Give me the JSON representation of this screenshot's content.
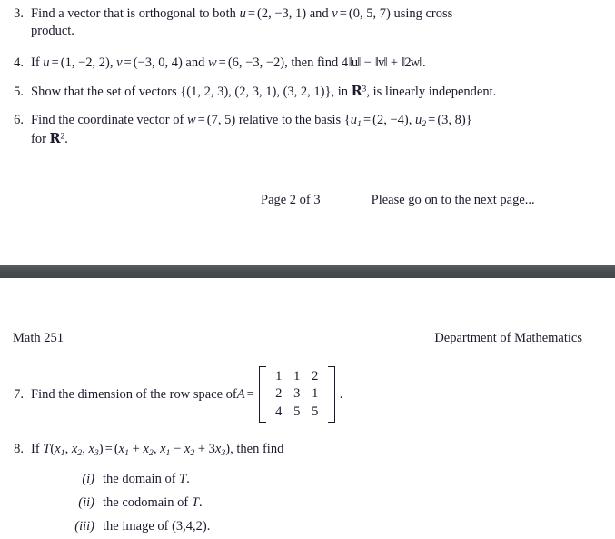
{
  "document": {
    "course": "Math 251",
    "department": "Department of Mathematics",
    "page_label": "Page 2 of 3",
    "continuation_note": "Please go on to the next page...",
    "divider_color": "#4a4e53"
  },
  "problems": {
    "q3": {
      "number": "3.",
      "line1_a": "Find a vector that is orthogonal to both ",
      "u": "u",
      "eq1": "=",
      "u_val": "(2, −3, 1)",
      "and": " and ",
      "v": "v",
      "eq2": "=",
      "v_val": "(0, 5, 7)",
      "line1_b": " using cross",
      "line2": "product."
    },
    "q4": {
      "number": "4.",
      "t1": "If ",
      "u": "u",
      "eq1": "=",
      "u_val": "(1, −2, 2),",
      "sep1": "  ",
      "v": "v",
      "eq2": "=",
      "v_val": "(−3, 0, 4)",
      "t2": " and ",
      "w": "w",
      "eq3": "=",
      "w_val": "(6, −3, −2),",
      "t3": " then find 4",
      "nu": "‖u‖",
      "minus": " − ",
      "nv": "‖v‖",
      "plus": " + ",
      "nw": "‖2w‖",
      "t4": "."
    },
    "q5": {
      "number": "5.",
      "t1": "Show that the set of vectors ",
      "set": "{(1, 2, 3), (2, 3, 1), (3, 2, 1)}",
      "t2": ", in ",
      "field": "R",
      "field_exp": "3",
      "t3": ", is linearly independent."
    },
    "q6": {
      "number": "6.",
      "t1": "Find the coordinate vector of ",
      "w": "w",
      "eq1": "=",
      "w_val": "(7, 5)",
      "t2": " relative to the basis ",
      "brace_open": "{",
      "u1": "u",
      "u1_sub": "1",
      "eq2": "=",
      "u1_val": "(2, −4),",
      "sep": "  ",
      "u2": "u",
      "u2_sub": "2",
      "eq3": "=",
      "u2_val": "(3, 8)",
      "brace_close": "}",
      "line2_a": "for ",
      "field": "R",
      "field_exp": "2",
      "line2_b": "."
    },
    "q7": {
      "number": "7.",
      "t1": "Find the dimension of the row space of ",
      "A": "A",
      "eq": "=",
      "matrix": [
        [
          "1",
          "1",
          "2"
        ],
        [
          "2",
          "3",
          "1"
        ],
        [
          "4",
          "5",
          "5"
        ]
      ],
      "period": "."
    },
    "q8": {
      "number": "8.",
      "t1": "If ",
      "T": "T",
      "args_open": "(",
      "x1": "x",
      "x1_sub": "1",
      "c1": ", ",
      "x2": "x",
      "x2_sub": "2",
      "c2": ", ",
      "x3": "x",
      "x3_sub": "3",
      "args_close": ")",
      "eq": "=",
      "rhs_open": "(",
      "r_x1": "x",
      "r_x1_sub": "1",
      "r_plus": " + ",
      "r_x2": "x",
      "r_x2_sub": "2",
      "r_c": ", ",
      "r_x1b": "x",
      "r_x1b_sub": "1",
      "r_minus": " − ",
      "r_x2b": "x",
      "r_x2b_sub": "2",
      "r_plus2": " + 3",
      "r_x3": "x",
      "r_x3_sub": "3",
      "rhs_close": ")",
      "t2": ", then find",
      "subitems": [
        {
          "label": "(i)",
          "text": "the domain of ",
          "var": "T",
          "tail": "."
        },
        {
          "label": "(ii)",
          "text": "the codomain of ",
          "var": "T",
          "tail": "."
        },
        {
          "label": "(iii)",
          "text": "the image of (3,4,2).",
          "var": "",
          "tail": ""
        }
      ]
    }
  }
}
